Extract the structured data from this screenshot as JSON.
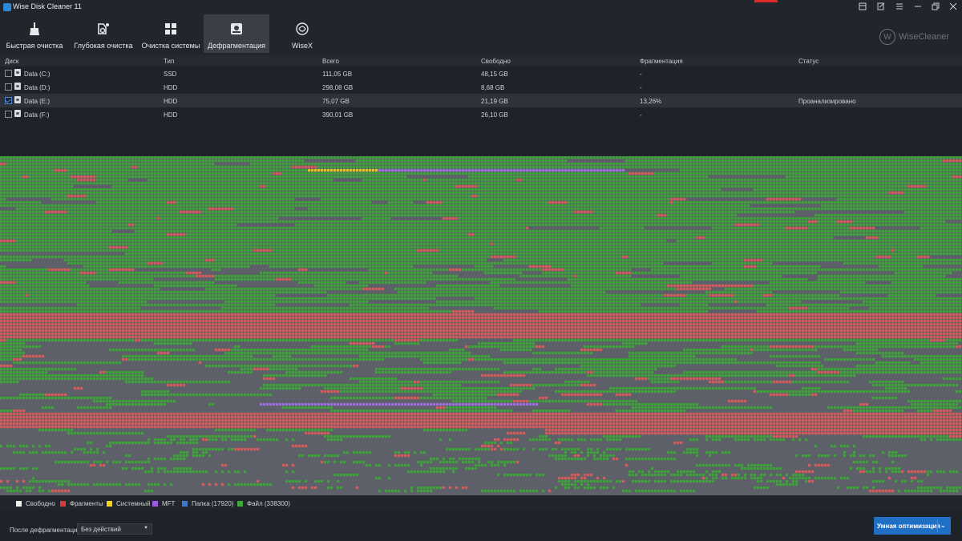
{
  "window": {
    "title": "Wise Disk Cleaner 11"
  },
  "toolbar": {
    "items": [
      {
        "label": "Быстрая очистка",
        "icon": "broom-icon"
      },
      {
        "label": "Глубокая очистка",
        "icon": "deep-clean-icon"
      },
      {
        "label": "Очистка системы",
        "icon": "windows-icon"
      },
      {
        "label": "Дефрагментация",
        "icon": "defrag-icon",
        "active": true
      },
      {
        "label": "WiseX",
        "icon": "wisex-icon"
      }
    ],
    "brand": "WiseCleaner"
  },
  "disks": {
    "headers": [
      "Диск",
      "Тип",
      "Всего",
      "Свободно",
      "Фрагментация",
      "Статус"
    ],
    "rows": [
      {
        "name": "Data (C:)",
        "type": "SSD",
        "total": "111,05 GB",
        "free": "48,15 GB",
        "frag": "-",
        "status": "",
        "checked": false
      },
      {
        "name": "Data (D:)",
        "type": "HDD",
        "total": "298,08 GB",
        "free": "8,68 GB",
        "frag": "-",
        "status": "",
        "checked": false
      },
      {
        "name": "Data (E:)",
        "type": "HDD",
        "total": "75,07 GB",
        "free": "21,19 GB",
        "frag": "13,26%",
        "status": "Проанализировано",
        "checked": true
      },
      {
        "name": "Data (F:)",
        "type": "HDD",
        "total": "390,01 GB",
        "free": "26,10 GB",
        "frag": "-",
        "status": "",
        "checked": false
      }
    ]
  },
  "legend": {
    "items": [
      {
        "label": "Свободно",
        "color": "#f0f0f0"
      },
      {
        "label": "Фрагменты",
        "color": "#d93a3a"
      },
      {
        "label": "Системный",
        "color": "#f2d21a"
      },
      {
        "label": "MFT",
        "color": "#9b5be0"
      },
      {
        "label": "Папка (17920)",
        "color": "#3a78d6"
      },
      {
        "label": "Файл (338300)",
        "color": "#3fa83a"
      }
    ]
  },
  "colors": {
    "file": "#41a83c",
    "fragment": "#de5f5f",
    "free": "#5d6069",
    "system": "#f0d425",
    "mft": "#a476e6",
    "accent": "#1f6fc5"
  },
  "footer": {
    "after_label": "После дефрагментации:",
    "after_value": "Без действий",
    "primary_button": "Умная оптимизация"
  }
}
